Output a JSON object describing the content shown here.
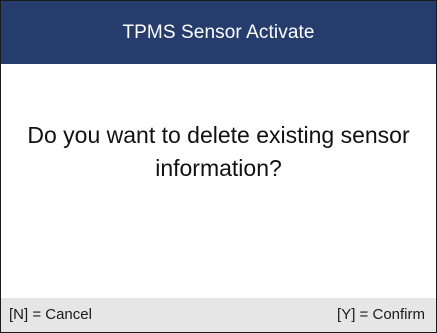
{
  "header": {
    "title": "TPMS Sensor Activate"
  },
  "dialog": {
    "message_line1": "Do you want to delete existing sensor",
    "message_line2": "information?"
  },
  "footer": {
    "cancel_label": "[N] = Cancel",
    "confirm_label": "[Y] = Confirm"
  },
  "colors": {
    "title_background": "#253c6d",
    "title_text": "#ffffff",
    "footer_background": "#e6e6e6",
    "body_background": "#ffffff"
  }
}
